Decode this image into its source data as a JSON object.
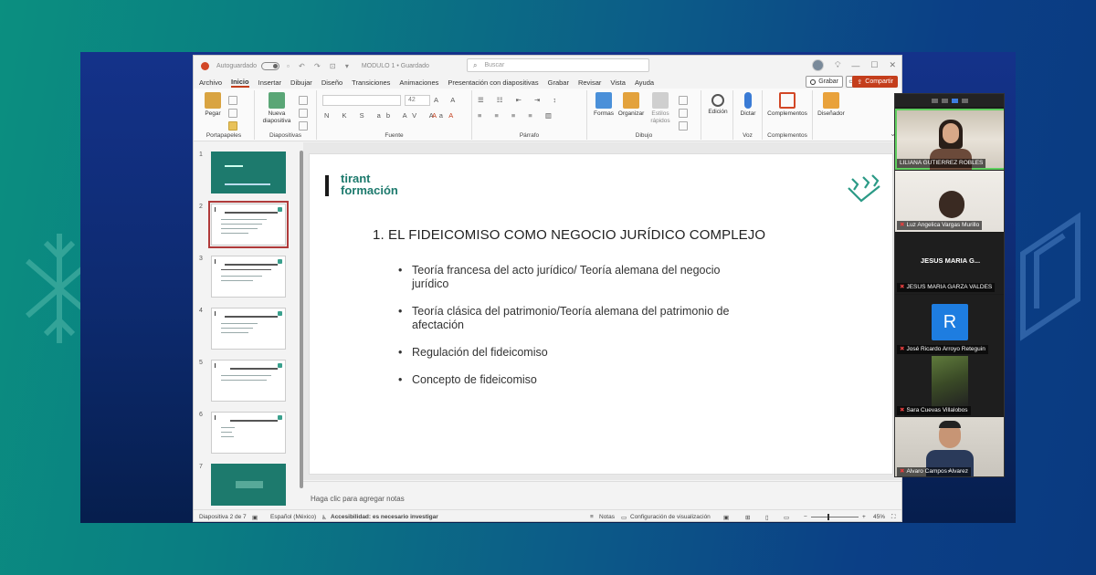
{
  "window": {
    "autosave_label": "Autoguardado",
    "doc_title": "MODULO 1 • Guardado",
    "search_placeholder": "Buscar"
  },
  "tabs": [
    "Archivo",
    "Inicio",
    "Insertar",
    "Dibujar",
    "Diseño",
    "Transiciones",
    "Animaciones",
    "Presentación con diapositivas",
    "Grabar",
    "Revisar",
    "Vista",
    "Ayuda"
  ],
  "active_tab": "Inicio",
  "buttons": {
    "grabar": "Grabar",
    "compartir": "Compartir"
  },
  "ribbon": {
    "pegar": "Pegar",
    "nueva_diapositiva": "Nueva",
    "nueva_diapositiva2": "diapositiva",
    "font_name": "",
    "font_size": "42",
    "formas": "Formas",
    "organizar": "Organizar",
    "estilos": "Estilos",
    "estilos2": "rápidos",
    "edicion": "Edición",
    "dictar": "Dictar",
    "complementos": "Complementos",
    "disenador": "Diseñador",
    "groups": {
      "portapapeles": "Portapapeles",
      "diapositivas": "Diapositivas",
      "fuente": "Fuente",
      "parrafo": "Párrafo",
      "dibujo": "Dibujo",
      "voz": "Voz",
      "complementos": "Complementos"
    }
  },
  "thumbnails": [
    {
      "num": "1"
    },
    {
      "num": "2"
    },
    {
      "num": "3"
    },
    {
      "num": "4"
    },
    {
      "num": "5"
    },
    {
      "num": "6"
    },
    {
      "num": "7"
    }
  ],
  "slide": {
    "brand_line1": "tirant",
    "brand_line2": "formación",
    "title": "1. EL FIDEICOMISO COMO NEGOCIO JURÍDICO COMPLEJO",
    "bullets": [
      "Teoría francesa del acto jurídico/ Teoría alemana del negocio jurídico",
      "Teoría clásica del patrimonio/Teoría alemana del patrimonio de afectación",
      "Regulación del fideicomiso",
      "Concepto de fideicomiso"
    ]
  },
  "notes_placeholder": "Haga clic para agregar notas",
  "status": {
    "slide_of": "Diapositiva 2 de 7",
    "language": "Español (México)",
    "accessibility": "Accesibilidad: es necesario investigar",
    "notas": "Notas",
    "config": "Configuración de visualización",
    "zoom": "45%"
  },
  "video": {
    "participants": [
      {
        "name": "LILIANA GUTIERREZ ROBLES",
        "muted": false
      },
      {
        "name": "Luz Angelica Vargas Murillo",
        "muted": true
      },
      {
        "name": "JESUS MARIA GARZA VALDES",
        "muted": true,
        "display": "JESUS MARIA G..."
      },
      {
        "name": "José Ricardo Arroyo Reteguin",
        "muted": true,
        "initial": "R"
      },
      {
        "name": "Sara Cuevas Villalobos",
        "muted": true
      },
      {
        "name": "Alvaro Campos Alvarez",
        "muted": true
      }
    ]
  },
  "colors": {
    "accent": "#c43e1c",
    "brand_teal": "#1d7a6d",
    "active_speaker": "#5fcf5f"
  }
}
